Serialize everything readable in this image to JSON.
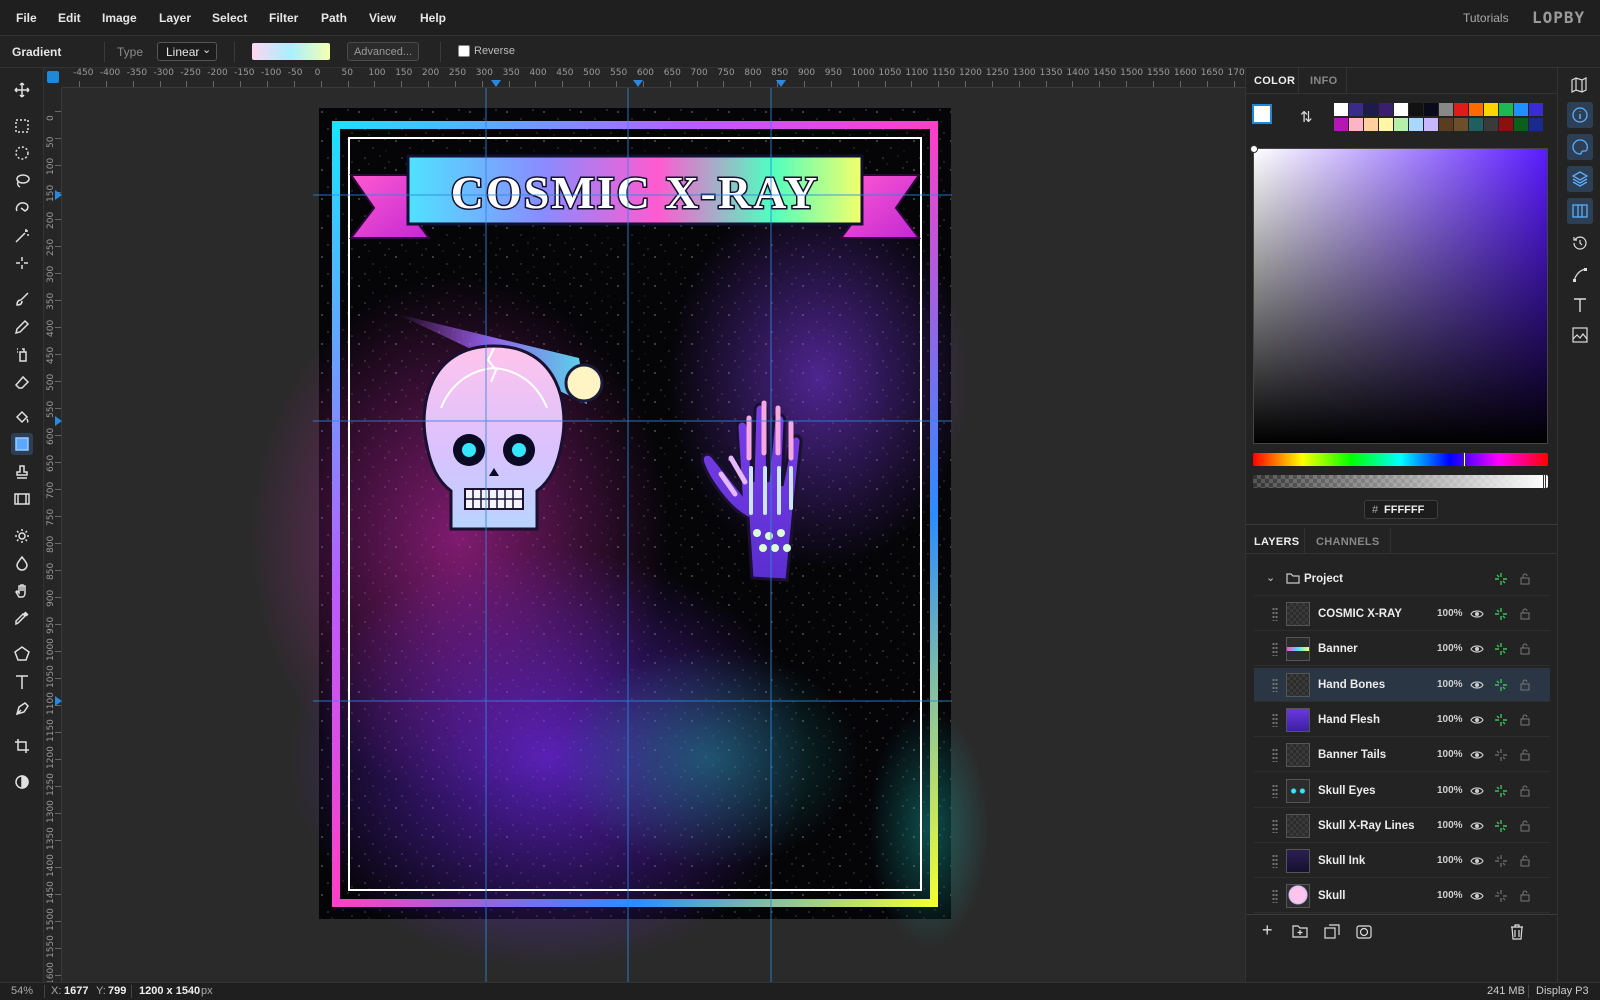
{
  "menu": {
    "items": [
      "File",
      "Edit",
      "Image",
      "Layer",
      "Select",
      "Filter",
      "Path",
      "View",
      "Help"
    ],
    "tutorials": "Tutorials",
    "logo": "LOPBY"
  },
  "options": {
    "tool_name": "Gradient",
    "type_label": "Type",
    "type_value": "Linear",
    "advanced_label": "Advanced...",
    "reverse_label": "Reverse"
  },
  "ruler": {
    "top": [
      "-450",
      "-400",
      "-350",
      "-300",
      "-250",
      "-200",
      "-150",
      "-100",
      "-50",
      "0",
      "50",
      "100",
      "150",
      "200",
      "250",
      "300",
      "350",
      "400",
      "450",
      "500",
      "550",
      "600",
      "650",
      "700",
      "750",
      "800",
      "850",
      "900",
      "950",
      "1000",
      "1050",
      "1100",
      "1150",
      "1200",
      "1250",
      "1300",
      "1350",
      "1400",
      "1450",
      "1500",
      "1550",
      "1600",
      "1650",
      "1700"
    ],
    "left": [
      "0",
      "50",
      "100",
      "150",
      "200",
      "250",
      "300",
      "350",
      "400",
      "450",
      "500",
      "550",
      "600",
      "650",
      "700",
      "750",
      "800",
      "850",
      "900",
      "950",
      "1000",
      "1050",
      "1100",
      "1150",
      "1200",
      "1250",
      "1300",
      "1350",
      "1400",
      "1450",
      "1500",
      "1550",
      "1600"
    ]
  },
  "artwork": {
    "title": "COSMIC X-RAY"
  },
  "color_panel": {
    "tabs": [
      "COLOR",
      "INFO"
    ],
    "hex_prefix": "#",
    "hex_value": "FFFFFF",
    "swatches_row1": [
      "#ffffff",
      "#3a2a8c",
      "#1e1a4a",
      "#3a1f6e",
      "#ffffff",
      "#111111",
      "#0a0a1a",
      "#888888",
      "#e01b1b",
      "#ff6a00",
      "#ffd400",
      "#1db954",
      "#1e90ff",
      "#3b2bd6"
    ],
    "swatches_row2": [
      "#b517b5",
      "#ffb3c6",
      "#ffcf9e",
      "#fff6a8",
      "#b6f0a8",
      "#a8d8ff",
      "#c8b6ff",
      "#5a3d1e",
      "#6b4f2a",
      "#1f5f5f",
      "#3a3a3a",
      "#8b1010",
      "#0a5f1a",
      "#1a2a8c"
    ]
  },
  "layers_panel": {
    "tabs": [
      "LAYERS",
      "CHANNELS"
    ],
    "group": "Project",
    "layers": [
      {
        "name": "COSMIC X-RAY",
        "opacity": "100%"
      },
      {
        "name": "Banner",
        "opacity": "100%"
      },
      {
        "name": "Hand Bones",
        "opacity": "100%"
      },
      {
        "name": "Hand Flesh",
        "opacity": "100%"
      },
      {
        "name": "Banner Tails",
        "opacity": "100%"
      },
      {
        "name": "Skull Eyes",
        "opacity": "100%"
      },
      {
        "name": "Skull X-Ray Lines",
        "opacity": "100%"
      },
      {
        "name": "Skull Ink",
        "opacity": "100%"
      },
      {
        "name": "Skull",
        "opacity": "100%"
      }
    ]
  },
  "status": {
    "zoom": "54%",
    "x_label": "X:",
    "x_value": "1677",
    "y_label": "Y:",
    "y_value": "799",
    "doc_size": "1200 x 1540",
    "doc_unit": "px",
    "memory": "241 MB",
    "color_profile": "Display P3"
  },
  "colors": {
    "accent": "#1e88d9",
    "selection": "#2a3644"
  }
}
